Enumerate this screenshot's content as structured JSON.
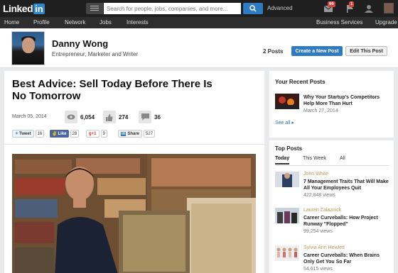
{
  "topbar": {
    "logo_text": "Linked",
    "logo_in": "in",
    "search_placeholder": "Search for people, jobs, companies, and more...",
    "advanced_label": "Advanced",
    "messages_badge": "66",
    "notifications_badge": "1"
  },
  "nav": {
    "items": [
      "Home",
      "Profile",
      "Network",
      "Jobs",
      "Interests"
    ],
    "business_services": "Business Services",
    "upgrade": "Upgrade"
  },
  "profile": {
    "name": "Danny Wong",
    "headline": "Entrepreneur, Marketer and Writer",
    "posts_count": "2 Posts",
    "create_post_label": "Create a New Post",
    "edit_post_label": "Edit This Post"
  },
  "article": {
    "title": "Best Advice: Sell Today Before There Is No Tomorrow",
    "date": "March 05, 2014",
    "views": "6,054",
    "likes": "274",
    "comments": "36",
    "share": {
      "tweet_label": "Tweet",
      "tweet_count": "16",
      "like_label": "Like",
      "like_count": "28",
      "gplus_label": "+1",
      "gplus_count": "9",
      "linkedin_label": "Share",
      "linkedin_count": "527"
    }
  },
  "recent_posts": {
    "heading": "Your Recent Posts",
    "items": [
      {
        "title": "Why Your Startup's Competitors Help More Than Hurt",
        "date": "March 27, 2014"
      }
    ],
    "see_all": "See all"
  },
  "top_posts": {
    "heading": "Top Posts",
    "tabs": [
      "Today",
      "This Week",
      "All"
    ],
    "items": [
      {
        "author": "John White",
        "title": "7 Management Traits That Will Make All Your Employees Quit",
        "views": "422,848 views"
      },
      {
        "author": "Lauren Zalaznick",
        "title": "Career Curveballs: How Project Runway \"Flopped\"",
        "views": "99,254 views"
      },
      {
        "author": "Sylvia Ann Hewlett",
        "title": "Career Curveballs: When Brains Only Get You So Far",
        "views": "54,615 views"
      }
    ]
  },
  "colors": {
    "linkedin_blue": "#2e7bc4",
    "topbar": "#1f1f1f",
    "nav": "#2d2d2d",
    "author_gold": "#b89a57"
  }
}
